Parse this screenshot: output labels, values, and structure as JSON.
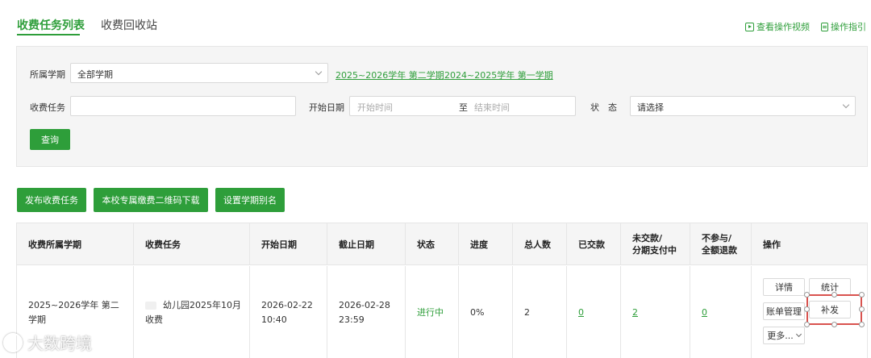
{
  "tabs": {
    "active": "收费任务列表",
    "inactive": "收费回收站"
  },
  "top_links": {
    "video": "查看操作视频",
    "guide": "操作指引"
  },
  "filter": {
    "term_label": "所属学期",
    "term_value": "全部学期",
    "term_links": [
      "2025~2026学年 第二学期",
      "2024~2025学年 第一学期"
    ],
    "task_label": "收费任务",
    "task_value": "",
    "start_label": "开始日期",
    "start_placeholder": "开始时间",
    "to": "至",
    "end_placeholder": "结束时间",
    "status_label": "状　态",
    "status_value": "请选择",
    "query": "查询"
  },
  "actions": [
    "发布收费任务",
    "本校专属缴费二维码下载",
    "设置学期别名"
  ],
  "table": {
    "headers": [
      "收费所属学期",
      "收费任务",
      "开始日期",
      "截止日期",
      "状态",
      "进度",
      "总人数",
      "已交款",
      "未交款/\n分期支付中",
      "不参与/\n全额退款",
      "操作"
    ],
    "row": {
      "term": "2025~2026学年 第二学期",
      "task": "幼儿园2025年10月收费",
      "start": "2026-02-22 10:40",
      "end": "2026-02-28 23:59",
      "status": "进行中",
      "progress": "0%",
      "total": "2",
      "paid": "0",
      "unpaid": "2",
      "exempt": "0"
    },
    "ops": {
      "detail": "详情",
      "stats": "统计",
      "bill": "账单管理",
      "supplement": "补发",
      "more": "更多..."
    }
  },
  "watermark": "大数跨境",
  "colors": {
    "accent": "#2e9e3a",
    "highlight": "#d9534f"
  }
}
